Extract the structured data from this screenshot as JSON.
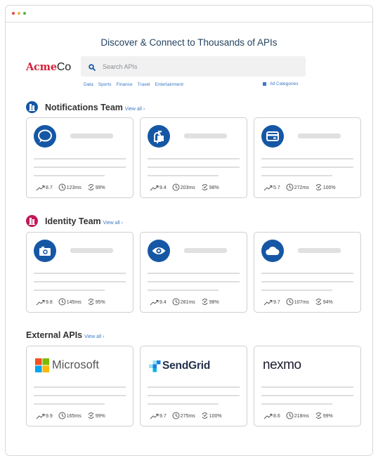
{
  "window": {
    "dots": [
      "#e0474c",
      "#f1b43b",
      "#4fb04a"
    ]
  },
  "headline": "Discover & Connect to Thousands of APIs",
  "logo": {
    "part1": "Acme",
    "part2": "Co"
  },
  "search": {
    "placeholder": "Search APIs",
    "value": ""
  },
  "categories": [
    "Data",
    "Sports",
    "Finance",
    "Travel",
    "Entertainment"
  ],
  "all_categories": "All Categories",
  "colors": {
    "accent": "#1557a5",
    "link": "#3b78c4",
    "logo_red": "#d1243b"
  },
  "sections": [
    {
      "title": "Notifications Team",
      "view_all": "View all",
      "badge_icon": "building-icon",
      "cards": [
        {
          "icon": "chat-bubble-icon",
          "score": "8.7",
          "latency": "123ms",
          "uptime": "99%"
        },
        {
          "icon": "mailbox-icon",
          "score": "9.4",
          "latency": "203ms",
          "uptime": "98%"
        },
        {
          "icon": "credit-card-icon",
          "score": "5.7",
          "latency": "272ms",
          "uptime": "100%"
        }
      ]
    },
    {
      "title": "Identity Team",
      "view_all": "View all",
      "badge_icon": "building-icon",
      "cards": [
        {
          "icon": "camera-icon",
          "score": "9.8",
          "latency": "145ms",
          "uptime": "95%"
        },
        {
          "icon": "eye-icon",
          "score": "9.4",
          "latency": "281ms",
          "uptime": "98%"
        },
        {
          "icon": "cloud-icon",
          "score": "9.7",
          "latency": "107ms",
          "uptime": "94%"
        }
      ]
    },
    {
      "title": "External APIs",
      "view_all": "View all",
      "cards": [
        {
          "brand": "Microsoft",
          "brand_icon": "microsoft-logo-icon",
          "score": "9.9",
          "latency": "165ms",
          "uptime": "99%"
        },
        {
          "brand": "SendGrid",
          "brand_icon": "sendgrid-logo-icon",
          "score": "9.7",
          "latency": "275ms",
          "uptime": "100%"
        },
        {
          "brand": "nexmo",
          "brand_icon": "nexmo-logo-icon",
          "score": "8.6",
          "latency": "218ms",
          "uptime": "99%"
        }
      ]
    }
  ]
}
